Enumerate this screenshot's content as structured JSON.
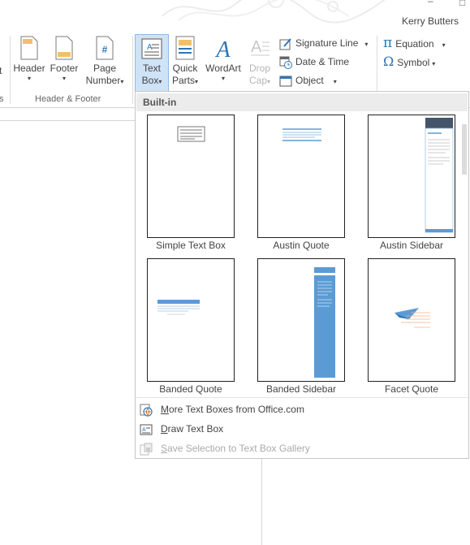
{
  "window": {
    "user": "Kerry Butters",
    "min_glyph": "–",
    "restore_glyph": "□"
  },
  "ribbon": {
    "cut_group_letter": "t",
    "cut_group_caption": "s",
    "header_footer": {
      "group_label": "Header & Footer",
      "header": "Header",
      "footer": "Footer",
      "page_number_line1": "Page",
      "page_number_line2": "Number",
      "caret": "▾"
    },
    "text": {
      "text_box_line1": "Text",
      "text_box_line2": "Box",
      "quick_parts_line1": "Quick",
      "quick_parts_line2": "Parts",
      "wordart": "WordArt",
      "drop_cap_line1": "Drop",
      "drop_cap_line2": "Cap",
      "signature_line": "Signature Line",
      "date_time": "Date & Time",
      "object": "Object"
    },
    "symbols": {
      "equation": "Equation",
      "symbol": "Symbol",
      "pi_glyph": "π",
      "omega_glyph": "Ω"
    }
  },
  "gallery": {
    "section_header": "Built-in",
    "items": [
      {
        "label": "Simple Text Box"
      },
      {
        "label": "Austin Quote"
      },
      {
        "label": "Austin Sidebar"
      },
      {
        "label": "Banded Quote"
      },
      {
        "label": "Banded Sidebar"
      },
      {
        "label": "Facet Quote"
      }
    ],
    "menu": {
      "more": "More Text Boxes from Office.com",
      "draw": "Draw Text Box",
      "save": "Save Selection to Text Box Gallery"
    }
  },
  "colors": {
    "accent_blue": "#5b9bd5",
    "dark_header": "#44546a",
    "facet_orange": "#f4b183",
    "active_button": "#cfe3f7"
  }
}
